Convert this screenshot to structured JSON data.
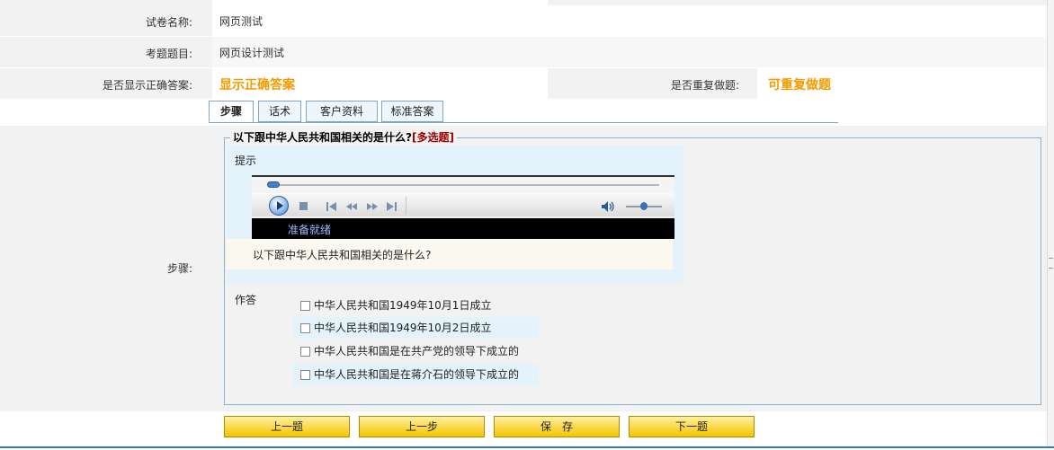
{
  "form": {
    "exam_name_label": "试卷名称:",
    "exam_name_value": "网页测试",
    "question_title_label": "考题题目:",
    "question_title_value": "网页设计测试",
    "show_answer_label": "是否显示正确答案:",
    "show_answer_value": "显示正确答案",
    "repeat_label": "是否重复做题:",
    "repeat_value": "可重复做题",
    "steps_label": "步骤:"
  },
  "tabs": [
    {
      "label": "步骤",
      "active": true
    },
    {
      "label": "话术",
      "active": false
    },
    {
      "label": "客户资料",
      "active": false
    },
    {
      "label": "标准答案",
      "active": false
    }
  ],
  "question": {
    "legend_text": "以下跟中华人民共和国相关的是什么?",
    "legend_type": "[多选题]",
    "hint_label": "提示",
    "player_status": "准备就绪",
    "question_text": "以下跟中华人民共和国相关的是什么?",
    "answer_label": "作答",
    "options": [
      {
        "label": "中华人民共和国1949年10月1日成立",
        "checked": false
      },
      {
        "label": "中华人民共和国1949年10月2日成立",
        "checked": false
      },
      {
        "label": "中华人民共和国是在共产党的领导下成立的",
        "checked": false
      },
      {
        "label": "中华人民共和国是在蒋介石的领导下成立的",
        "checked": false
      }
    ]
  },
  "buttons": {
    "prev_question": "上一题",
    "prev_step": "上一步",
    "save": "保　存",
    "next_question": "下一题"
  },
  "colors": {
    "accent_orange": "#f59a00",
    "tab_border": "#7aa6c8",
    "button_yellow": "#f5c400",
    "legend_type_red": "#a00000"
  },
  "player": {
    "progress": 0.02,
    "volume": 0.45
  }
}
